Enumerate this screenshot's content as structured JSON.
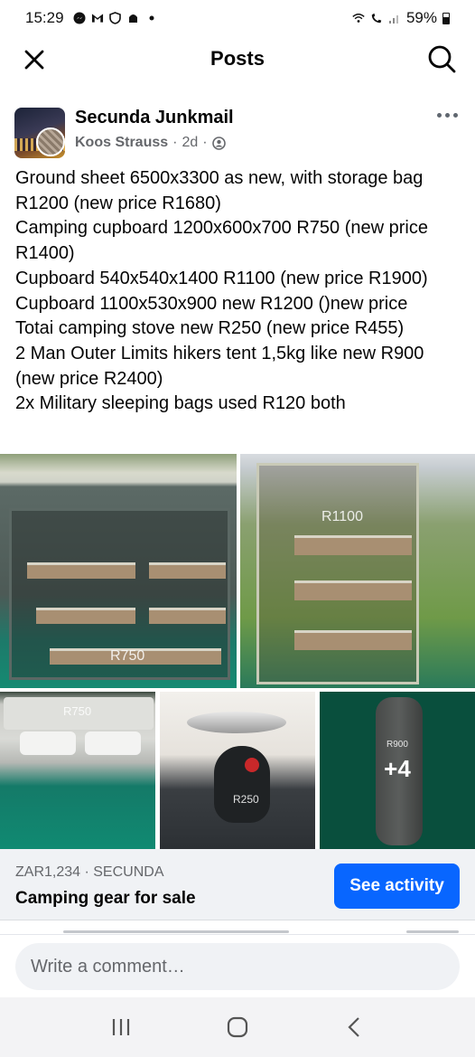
{
  "status_bar": {
    "time": "15:29",
    "battery": "59%",
    "icons": [
      "messenger-icon",
      "gmail-icon",
      "shield-icon",
      "android-icon",
      "dot-icon",
      "wifi-icon",
      "wifi-calling-icon",
      "signal-icon"
    ]
  },
  "header": {
    "title": "Posts",
    "close_icon": "close-icon",
    "search_icon": "search-icon"
  },
  "post": {
    "group_name": "Secunda Junkmail",
    "author": "Koos Strauss",
    "time": "2d",
    "separator": "·",
    "audience_icon": "group-audience-icon",
    "text_lines": [
      "Ground sheet 6500x3300 as new, with storage bag R1200 (new price R1680)",
      "Camping cupboard 1200x600x700 R750 (new price R1400)",
      "Cupboard 540x540x1400 R1100 (new price R1900)",
      "Cupboard 1100x530x900 new R1200 ()new price",
      "Totai camping stove new R250 (new price R455)",
      "2 Man Outer Limits hikers tent 1,5kg like new R900 (new price R2400)",
      "2x Military sleeping bags used  R120 both"
    ],
    "photo_labels": [
      "R750",
      "R1100",
      "R750",
      "R250",
      "R900"
    ],
    "more_photos": "+4"
  },
  "listing": {
    "price_location": "ZAR1,234 · SECUNDA",
    "title": "Camping gear for sale",
    "button_label": "See activity",
    "button_color": "#0866ff"
  },
  "comment": {
    "placeholder": "Write a comment…"
  },
  "navbar": {
    "icons": [
      "recent-apps-icon",
      "home-icon",
      "back-icon"
    ]
  }
}
